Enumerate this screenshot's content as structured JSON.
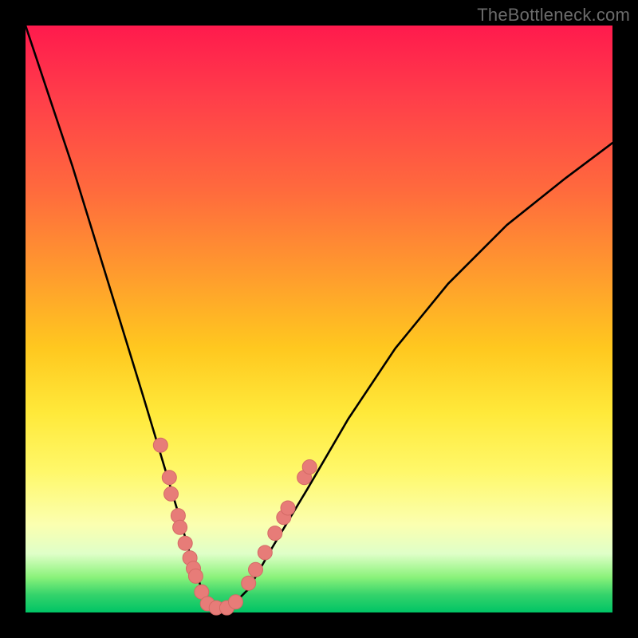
{
  "watermark": "TheBottleneck.com",
  "chart_data": {
    "type": "line",
    "title": "",
    "xlabel": "",
    "ylabel": "",
    "xlim": [
      0,
      100
    ],
    "ylim": [
      0,
      100
    ],
    "grid": false,
    "legend": false,
    "notes": "V-shaped bottleneck curve over rainbow gradient. Axes are unlabeled in the image; values below are pixel-normalized percentages estimated from the figure (x left→right, y representing mismatch where 0=bottom/optimal and 100=top/worst).",
    "series": [
      {
        "name": "bottleneck-curve",
        "x": [
          0,
          4,
          8,
          12,
          16,
          20,
          23,
          26,
          28,
          30,
          31.5,
          33,
          35,
          38,
          42,
          48,
          55,
          63,
          72,
          82,
          92,
          100
        ],
        "y": [
          100,
          88,
          76,
          63,
          50,
          37,
          27,
          17,
          10,
          4,
          1,
          0.5,
          1,
          4,
          11,
          21,
          33,
          45,
          56,
          66,
          74,
          80
        ]
      }
    ],
    "markers": {
      "name": "highlighted-points",
      "color": "#e77c78",
      "points": [
        {
          "x": 23.0,
          "y": 28.5
        },
        {
          "x": 24.5,
          "y": 23.0
        },
        {
          "x": 24.8,
          "y": 20.2
        },
        {
          "x": 26.0,
          "y": 16.5
        },
        {
          "x": 26.3,
          "y": 14.5
        },
        {
          "x": 27.2,
          "y": 11.8
        },
        {
          "x": 28.0,
          "y": 9.3
        },
        {
          "x": 28.6,
          "y": 7.5
        },
        {
          "x": 29.0,
          "y": 6.2
        },
        {
          "x": 30.0,
          "y": 3.5
        },
        {
          "x": 31.0,
          "y": 1.5
        },
        {
          "x": 32.5,
          "y": 0.8
        },
        {
          "x": 34.3,
          "y": 0.8
        },
        {
          "x": 35.8,
          "y": 1.8
        },
        {
          "x": 38.0,
          "y": 5.0
        },
        {
          "x": 39.2,
          "y": 7.3
        },
        {
          "x": 40.8,
          "y": 10.2
        },
        {
          "x": 42.5,
          "y": 13.5
        },
        {
          "x": 44.0,
          "y": 16.2
        },
        {
          "x": 44.7,
          "y": 17.8
        },
        {
          "x": 47.5,
          "y": 23.0
        },
        {
          "x": 48.4,
          "y": 24.8
        }
      ]
    }
  }
}
